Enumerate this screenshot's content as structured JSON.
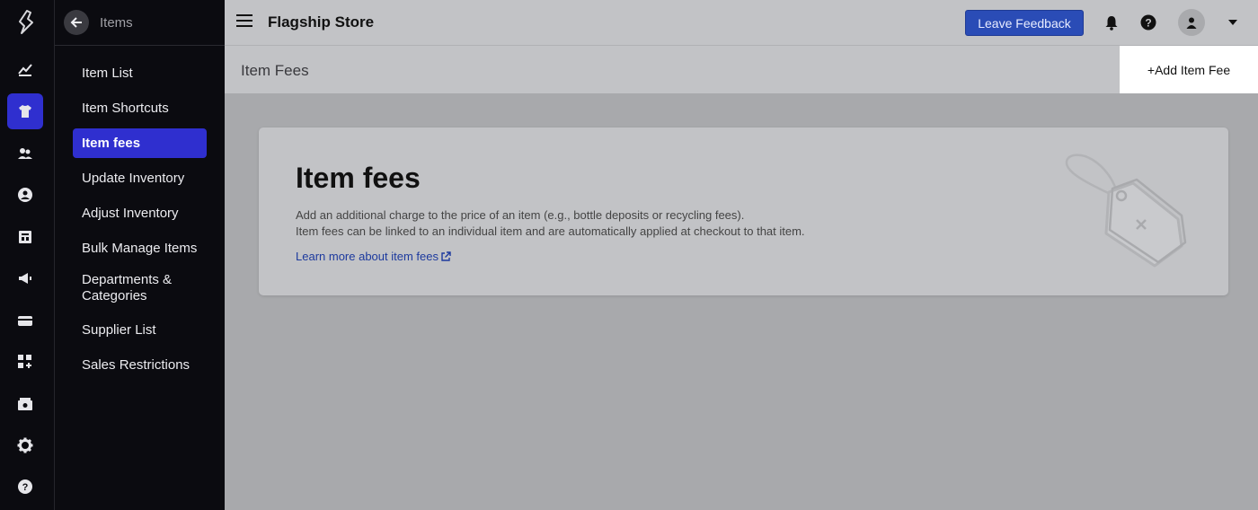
{
  "rail": {
    "items": [
      {
        "name": "analytics"
      },
      {
        "name": "items",
        "active": true
      },
      {
        "name": "customers"
      },
      {
        "name": "account"
      },
      {
        "name": "reports"
      },
      {
        "name": "marketing"
      },
      {
        "name": "payments"
      },
      {
        "name": "add-ons"
      },
      {
        "name": "store"
      },
      {
        "name": "settings"
      },
      {
        "name": "help"
      }
    ]
  },
  "sidebar": {
    "title": "Items",
    "items": [
      {
        "label": "Item List"
      },
      {
        "label": "Item Shortcuts"
      },
      {
        "label": "Item fees",
        "active": true
      },
      {
        "label": "Update Inventory"
      },
      {
        "label": "Adjust Inventory"
      },
      {
        "label": "Bulk Manage Items"
      },
      {
        "label": "Departments & Categories"
      },
      {
        "label": "Supplier List"
      },
      {
        "label": "Sales Restrictions"
      }
    ]
  },
  "topbar": {
    "store_name": "Flagship Store",
    "feedback_label": "Leave Feedback"
  },
  "subheader": {
    "title": "Item Fees",
    "add_label": "+Add Item Fee"
  },
  "card": {
    "title": "Item fees",
    "desc_line1": "Add an additional charge to the price of an item (e.g., bottle deposits or recycling fees).",
    "desc_line2": "Item fees can be linked to an individual item and are automatically applied at checkout to that item.",
    "link_label": "Learn more about item fees"
  },
  "colors": {
    "accent": "#2f2fcf",
    "feedback_button": "#2a4cb6",
    "link": "#1d3a9e",
    "sidebar_bg": "#0b0b10"
  }
}
